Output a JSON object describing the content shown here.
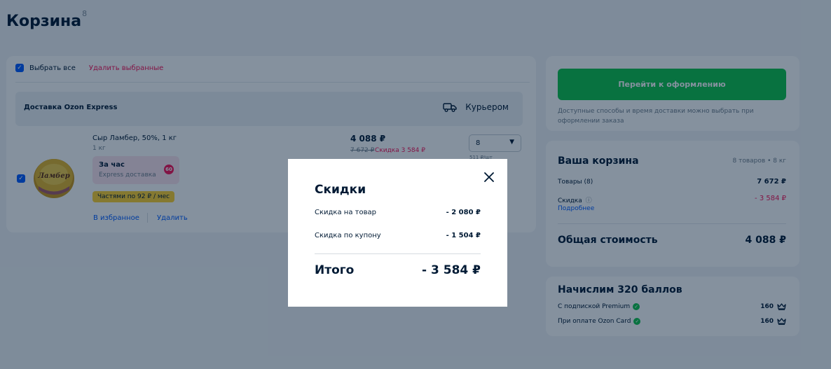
{
  "page": {
    "title": "Корзина",
    "count": "8"
  },
  "cart_list": {
    "select_all_label": "Выбрать все",
    "delete_selected_label": "Удалить выбранные",
    "delivery_title": "Доставка Ozon Express",
    "delivery_method": "Курьером",
    "item": {
      "name": "Сыр Ламбер, 50%, 1 кг",
      "weight": "1 кг",
      "express_title": "За час",
      "express_subtitle": "Express доставка",
      "express_icon_text": "60",
      "installments": "Частями по 92 ₽ / мес",
      "favorite_label": "В избранное",
      "delete_label": "Удалить",
      "price": "4 088 ₽",
      "old_price": "7 672 ₽",
      "discount_label": "Скидка 3 584 ₽",
      "quantity": "8",
      "unit_price": "511 ₽/шт",
      "image_label": "Ламбер"
    }
  },
  "checkout": {
    "button_label": "Перейти к оформлению",
    "note": "Доступные способы и время доставки можно выбрать при оформлении заказа"
  },
  "summary": {
    "title": "Ваша корзина",
    "meta": "8 товаров • 8 кг",
    "goods_label": "Товары (8)",
    "goods_value": "7 672 ₽",
    "discount_label": "Скидка",
    "discount_value": "- 3 584 ₽",
    "more_label": "Подробнее",
    "total_label": "Общая стоимость",
    "total_value": "4 088 ₽"
  },
  "points": {
    "title": "Начислим 320 баллов",
    "rows": [
      {
        "label": "С подпиской Premium",
        "value": "160"
      },
      {
        "label": "При оплате Ozon Card",
        "value": "160"
      }
    ]
  },
  "modal": {
    "title": "Скидки",
    "rows": [
      {
        "label": "Скидка на товар",
        "value": "- 2 080 ₽"
      },
      {
        "label": "Скидка по купону",
        "value": "- 1 504 ₽"
      }
    ],
    "total_label": "Итого",
    "total_value": "- 3 584 ₽"
  },
  "colors": {
    "accent": "#005bff",
    "checkout_green": "#10c44c",
    "discount_red": "#f91155",
    "installments_yellow": "#ffd12e"
  }
}
